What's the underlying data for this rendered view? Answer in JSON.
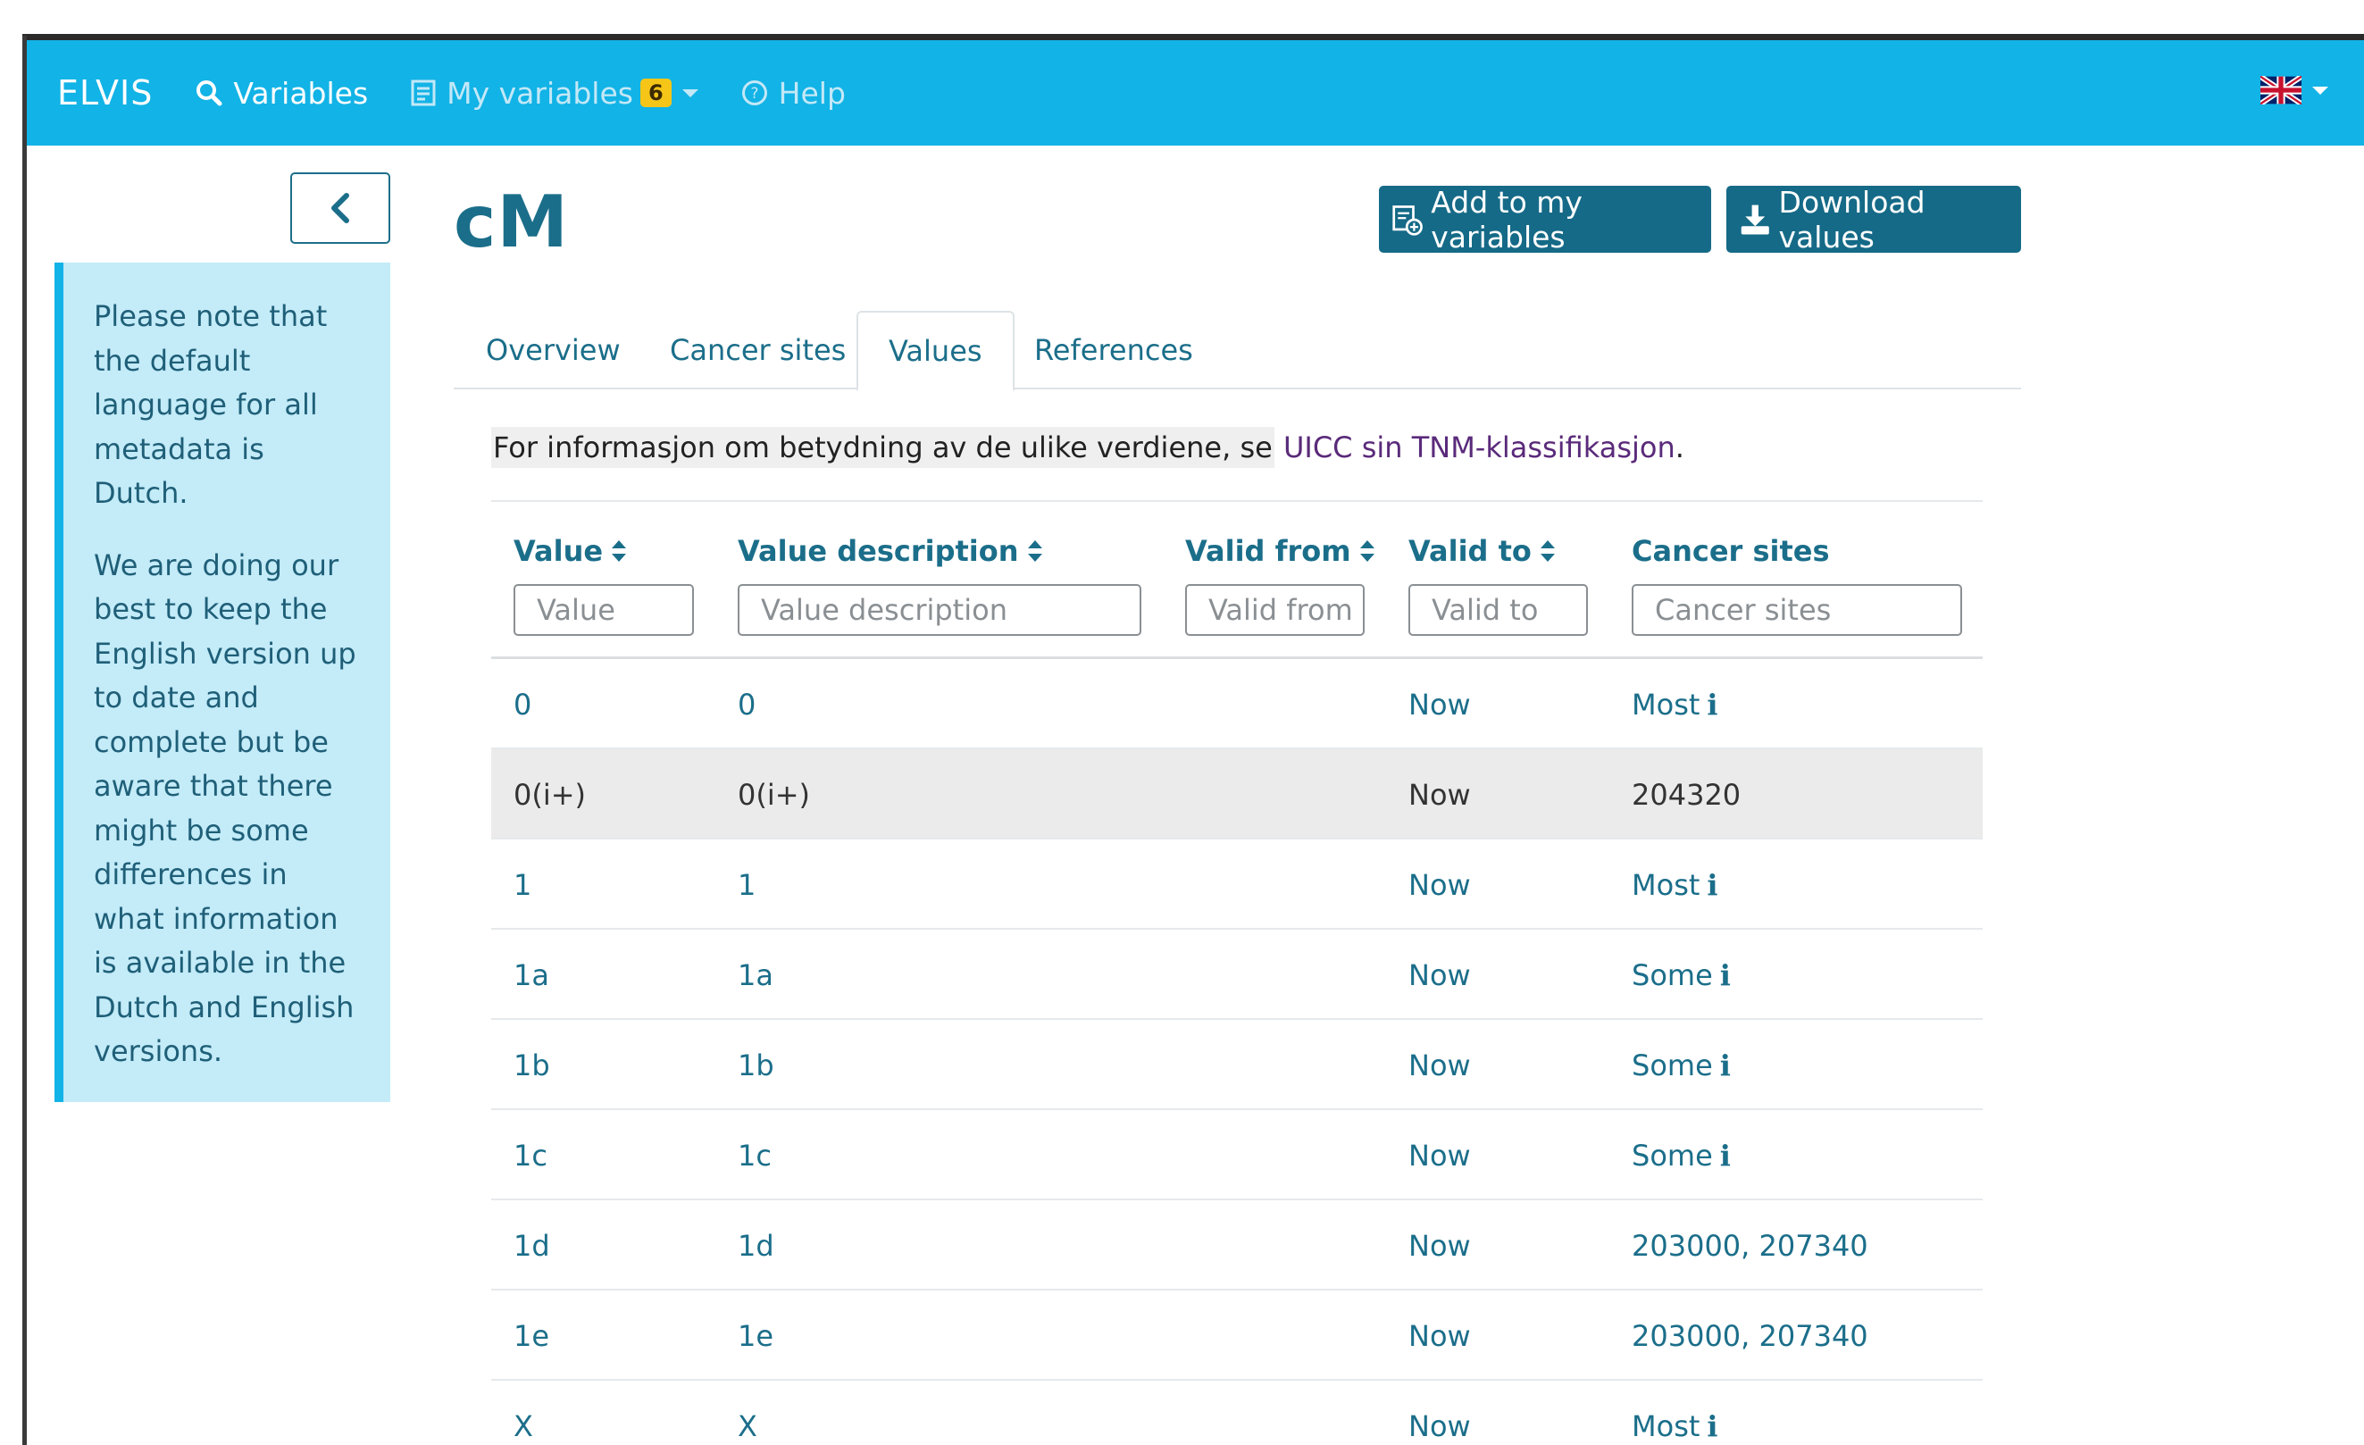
{
  "nav": {
    "brand": "ELVIS",
    "variables": "Variables",
    "my_variables": "My variables",
    "my_variables_count": "6",
    "help": "Help"
  },
  "sidebar": {
    "notice_p1": "Please note that the default language for all metadata is Dutch.",
    "notice_p2": "We are doing our best to keep the English version up to date and complete but be aware that there might be some differences in what information is available in the Dutch and English versions."
  },
  "page": {
    "title": "cM",
    "add_button": "Add to my variables",
    "download_button": "Download values"
  },
  "tabs": [
    "Overview",
    "Cancer sites",
    "Values",
    "References"
  ],
  "active_tab": "Values",
  "info": {
    "text": "For informasjon om betydning av de ulike verdiene, se",
    "link": "UICC sin TNM-klassifikasjon",
    "end": "."
  },
  "table": {
    "headers": {
      "value": "Value",
      "description": "Value description",
      "valid_from": "Valid from",
      "valid_to": "Valid to",
      "cancer_sites": "Cancer sites"
    },
    "placeholders": {
      "value": "Value",
      "description": "Value description",
      "valid_from": "Valid from",
      "valid_to": "Valid to",
      "cancer_sites": "Cancer sites"
    },
    "rows": [
      {
        "value": "0",
        "description": "0",
        "valid_from": "",
        "valid_to": "Now",
        "cancer_sites": "Most"
      },
      {
        "value": "0(i+)",
        "description": "0(i+)",
        "valid_from": "",
        "valid_to": "Now",
        "cancer_sites": "204320"
      },
      {
        "value": "1",
        "description": "1",
        "valid_from": "",
        "valid_to": "Now",
        "cancer_sites": "Most"
      },
      {
        "value": "1a",
        "description": "1a",
        "valid_from": "",
        "valid_to": "Now",
        "cancer_sites": "Some"
      },
      {
        "value": "1b",
        "description": "1b",
        "valid_from": "",
        "valid_to": "Now",
        "cancer_sites": "Some"
      },
      {
        "value": "1c",
        "description": "1c",
        "valid_from": "",
        "valid_to": "Now",
        "cancer_sites": "Some"
      },
      {
        "value": "1d",
        "description": "1d",
        "valid_from": "",
        "valid_to": "Now",
        "cancer_sites": "203000, 207340"
      },
      {
        "value": "1e",
        "description": "1e",
        "valid_from": "",
        "valid_to": "Now",
        "cancer_sites": "203000, 207340"
      },
      {
        "value": "X",
        "description": "X",
        "valid_from": "",
        "valid_to": "Now",
        "cancer_sites": "Most"
      }
    ]
  },
  "colors": {
    "navbar": "#12b3e6",
    "primary_text": "#1b6e8a",
    "button_bg": "#156a87",
    "notice_bg": "#c3ebf8",
    "badge": "#f5c518"
  },
  "icons": {
    "info_glyph": "i",
    "flag": "uk-flag-icon"
  }
}
